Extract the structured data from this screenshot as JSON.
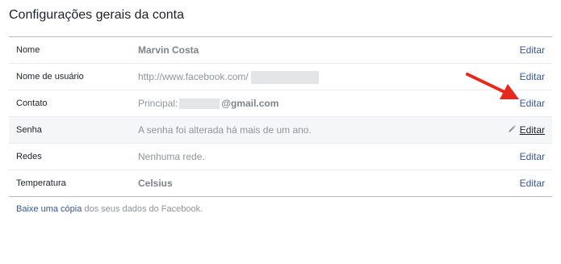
{
  "header": {
    "title": "Configurações gerais da conta"
  },
  "rows": [
    {
      "label": "Nome",
      "value": "Marvin Costa",
      "edit": "Editar"
    },
    {
      "label": "Nome de usuário",
      "value": "http://www.facebook.com/",
      "edit": "Editar"
    },
    {
      "label": "Contato",
      "value_prefix": "Principal:",
      "value_suffix": "@gmail.com",
      "edit": "Editar"
    },
    {
      "label": "Senha",
      "value": "A senha foi alterada há mais de um ano.",
      "edit": "Editar"
    },
    {
      "label": "Redes",
      "value": "Nenhuma rede.",
      "edit": "Editar"
    },
    {
      "label": "Temperatura",
      "value": "Celsius",
      "edit": "Editar"
    }
  ],
  "footer": {
    "link_text": "Baixe uma cópia",
    "rest_text": " dos seus dados do Facebook."
  },
  "icons": {
    "pencil": "pencil-icon",
    "arrow": "red-arrow-annotation"
  },
  "colors": {
    "link": "#365899",
    "arrow": "#e8281c",
    "muted_text": "#90949c"
  }
}
